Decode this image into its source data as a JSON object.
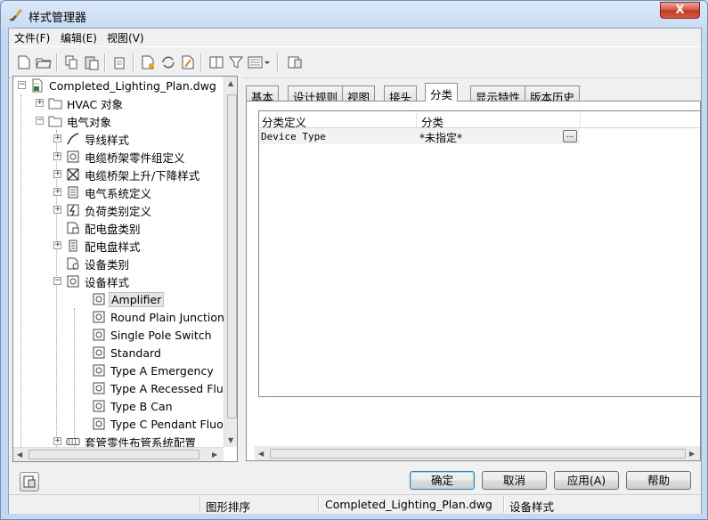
{
  "window": {
    "title": "样式管理器",
    "close_label": "X"
  },
  "menu": [
    {
      "label": "文件(F)"
    },
    {
      "label": "编辑(E)"
    },
    {
      "label": "视图(V)"
    }
  ],
  "tree": {
    "root": "Completed_Lighting_Plan.dwg",
    "hvac": "HVAC 对象",
    "electrical": "电气对象",
    "items": [
      "导线样式",
      "电缆桥架零件组定义",
      "电缆桥架上升/下降样式",
      "电气系统定义",
      "负荷类别定义",
      "配电盘类别",
      "配电盘样式",
      "设备类别",
      "设备样式"
    ],
    "device_styles": [
      "Amplifier",
      "Round Plain Junction B",
      "Single Pole Switch",
      "Standard",
      "Type A Emergency",
      "Type A Recessed Fluor",
      "Type B Can",
      "Type C Pendant Fluore"
    ],
    "last": "套管零件布管系统配置"
  },
  "tabs": [
    {
      "label": "基本"
    },
    {
      "label": "设计规则"
    },
    {
      "label": "视图"
    },
    {
      "label": "接头"
    },
    {
      "label": "分类"
    },
    {
      "label": "显示特性"
    },
    {
      "label": "版本历史"
    }
  ],
  "grid": {
    "headers": [
      "分类定义",
      "分类"
    ],
    "row": {
      "definition": "Device Type",
      "value": "*未指定*",
      "button": "..."
    }
  },
  "buttons": {
    "ok": "确定",
    "cancel": "取消",
    "apply": "应用(A)",
    "help": "帮助"
  },
  "status": {
    "sort": "图形排序",
    "file": "Completed_Lighting_Plan.dwg",
    "style": "设备样式"
  }
}
